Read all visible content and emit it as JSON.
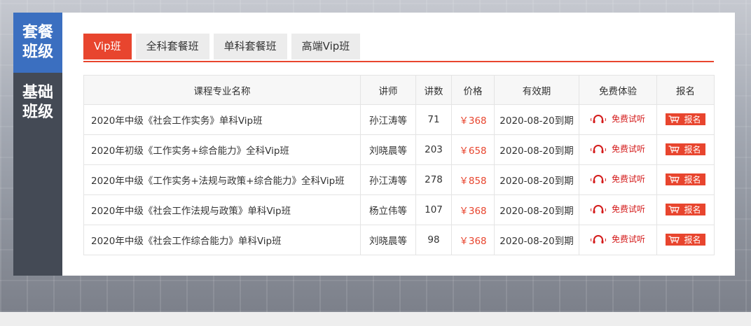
{
  "sidebar": {
    "items": [
      {
        "line1": "套餐",
        "line2": "班级",
        "active": true
      },
      {
        "line1": "基础",
        "line2": "班级",
        "active": false
      }
    ]
  },
  "tabs": [
    {
      "label": "Vip班",
      "active": true
    },
    {
      "label": "全科套餐班",
      "active": false
    },
    {
      "label": "单科套餐班",
      "active": false
    },
    {
      "label": "高端Vip班",
      "active": false
    }
  ],
  "table": {
    "headers": {
      "name": "课程专业名称",
      "teacher": "讲师",
      "lectures": "讲数",
      "price": "价格",
      "validity": "有效期",
      "trial": "免费体验",
      "signup": "报名"
    },
    "rows": [
      {
        "name": "2020年中级《社会工作实务》单科Vip班",
        "teacher": "孙江涛等",
        "lectures": "71",
        "price": "￥368",
        "validity": "2020-08-20到期",
        "trial": "免费试听",
        "signup": "报名"
      },
      {
        "name": "2020年初级《工作实务+综合能力》全科Vip班",
        "teacher": "刘晓晨等",
        "lectures": "203",
        "price": "￥658",
        "validity": "2020-08-20到期",
        "trial": "免费试听",
        "signup": "报名"
      },
      {
        "name": "2020年中级《工作实务+法规与政策+综合能力》全科Vip班",
        "teacher": "孙江涛等",
        "lectures": "278",
        "price": "￥858",
        "validity": "2020-08-20到期",
        "trial": "免费试听",
        "signup": "报名"
      },
      {
        "name": "2020年中级《社会工作法规与政策》单科Vip班",
        "teacher": "杨立伟等",
        "lectures": "107",
        "price": "￥368",
        "validity": "2020-08-20到期",
        "trial": "免费试听",
        "signup": "报名"
      },
      {
        "name": "2020年中级《社会工作综合能力》单科Vip班",
        "teacher": "刘晓晨等",
        "lectures": "98",
        "price": "￥368",
        "validity": "2020-08-20到期",
        "trial": "免费试听",
        "signup": "报名"
      }
    ]
  },
  "icons": {
    "trial": "headphones-icon",
    "signup": "cart-icon"
  },
  "colors": {
    "accent": "#e8452e",
    "sidebar_active": "#3b6fc0",
    "sidebar_bg": "#444a55",
    "trial_text": "#d41b1b"
  }
}
